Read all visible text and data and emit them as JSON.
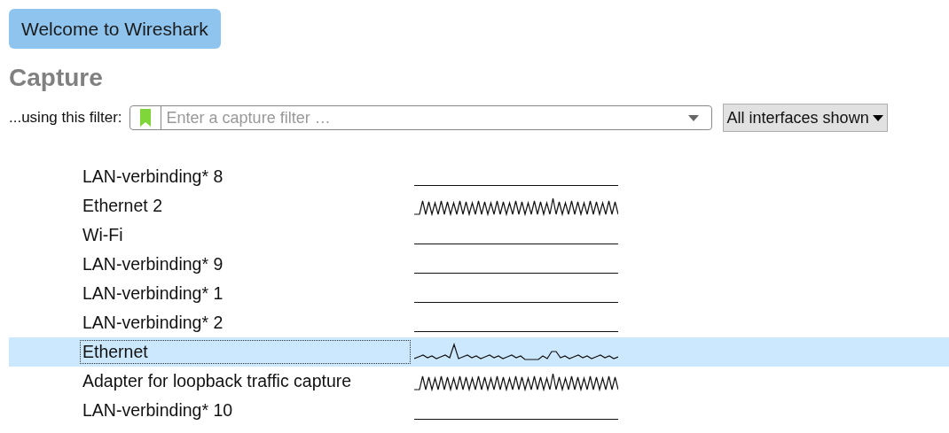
{
  "welcome_button": "Welcome to Wireshark",
  "section_title": "Capture",
  "filter": {
    "label": "...using this filter:",
    "placeholder": "Enter a capture filter …"
  },
  "interfaces_dropdown": "All interfaces shown",
  "interfaces": [
    {
      "name": "LAN-verbinding* 8",
      "selected": false,
      "kind": "idle"
    },
    {
      "name": "Ethernet 2",
      "selected": false,
      "kind": "busy"
    },
    {
      "name": "Wi-Fi",
      "selected": false,
      "kind": "idle"
    },
    {
      "name": "LAN-verbinding* 9",
      "selected": false,
      "kind": "idle"
    },
    {
      "name": "LAN-verbinding* 1",
      "selected": false,
      "kind": "idle"
    },
    {
      "name": "LAN-verbinding* 2",
      "selected": false,
      "kind": "idle"
    },
    {
      "name": "Ethernet",
      "selected": true,
      "kind": "spiky"
    },
    {
      "name": "Adapter for loopback traffic capture",
      "selected": false,
      "kind": "busy"
    },
    {
      "name": "LAN-verbinding* 10",
      "selected": false,
      "kind": "idle"
    }
  ]
}
